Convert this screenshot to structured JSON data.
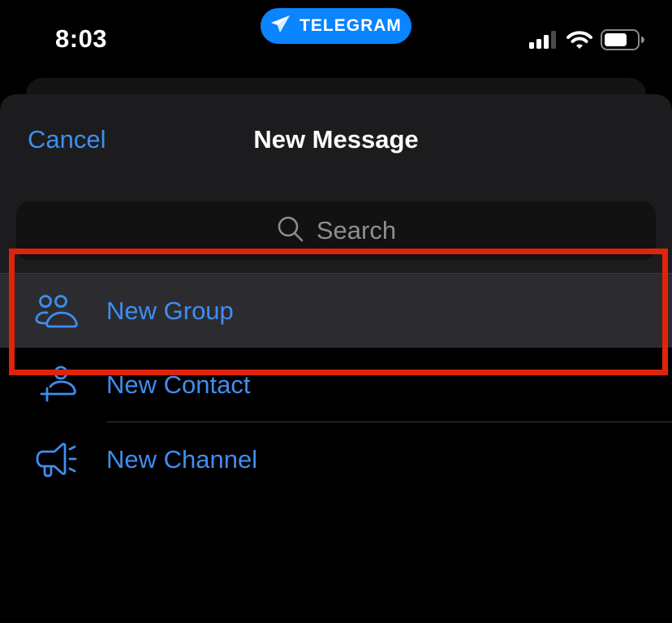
{
  "status_bar": {
    "time": "8:03",
    "app_pill": {
      "label": "TELEGRAM",
      "icon": "telegram-plane-icon",
      "color": "#0a84ff"
    },
    "icons": [
      "cellular-signal-icon",
      "wifi-icon",
      "battery-icon"
    ]
  },
  "sheet": {
    "cancel_label": "Cancel",
    "title": "New Message",
    "search": {
      "placeholder": "Search",
      "icon": "search-icon"
    }
  },
  "menu": {
    "items": [
      {
        "label": "New Group",
        "icon": "group-icon",
        "highlighted": true
      },
      {
        "label": "New Contact",
        "icon": "add-contact-icon",
        "highlighted": false
      },
      {
        "label": "New Channel",
        "icon": "megaphone-icon",
        "highlighted": false
      }
    ]
  },
  "colors": {
    "accent": "#3e8ef0",
    "annotation": "#e0230b",
    "sheet_header": "#1c1c1e",
    "highlight_row": "#2c2c30"
  }
}
